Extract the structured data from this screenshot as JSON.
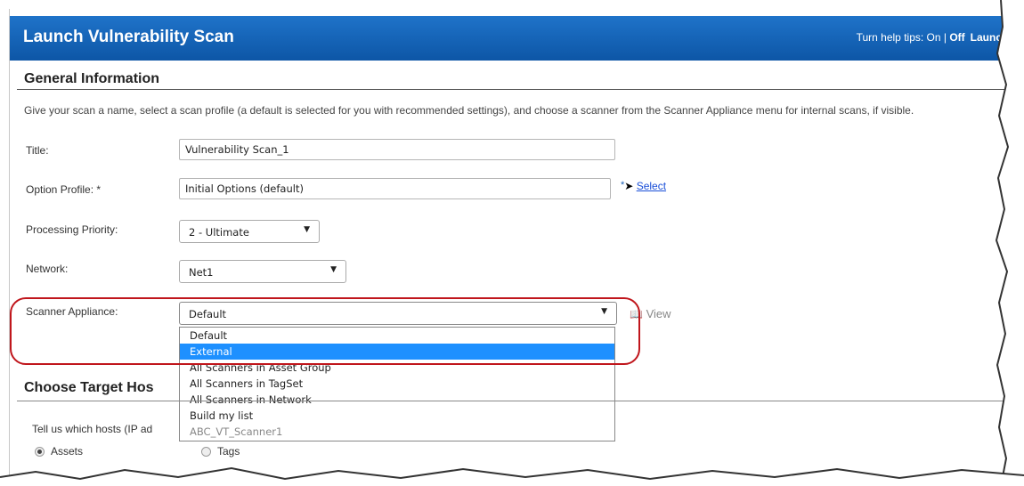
{
  "header": {
    "title": "Launch Vulnerability Scan",
    "help_tips_text": "Turn help tips: On | ",
    "help_tips_off": "Off",
    "launch_help": "Launch He"
  },
  "general": {
    "title": "General Information",
    "description": "Give your scan a name, select a scan profile (a default is selected for you with recommended settings), and choose a scanner from the Scanner Appliance menu for internal scans, if visible."
  },
  "form": {
    "title_label": "Title:",
    "title_value": "Vulnerability Scan_1",
    "option_profile_label": "Option Profile: *",
    "option_profile_value": "Initial Options (default)",
    "option_profile_star": "*",
    "select_link": "Select",
    "priority_label": "Processing Priority:",
    "priority_value": "2 - Ultimate",
    "network_label": "Network:",
    "network_value": "Net1",
    "scanner_label": "Scanner Appliance:",
    "scanner_value": "Default",
    "view_link": "View"
  },
  "scanner_options": [
    "Default",
    "External",
    "All Scanners in Asset Group",
    "All Scanners in TagSet",
    "All Scanners in Network",
    "Build my list",
    "ABC_VT_Scanner1"
  ],
  "scanner_selected_index": 1,
  "target": {
    "title": "Choose Target Hos",
    "tell_text": "Tell us which hosts (IP ad",
    "assets_label": "Assets",
    "tags_label": "Tags"
  },
  "colors": {
    "header_blue": "#0d56a6",
    "highlight_red": "#c0161c",
    "selected_option": "#1e90ff",
    "link_blue": "#1a4fd8"
  },
  "icons": {
    "arrow": "▼",
    "cursor": "➤",
    "view": "📖"
  }
}
